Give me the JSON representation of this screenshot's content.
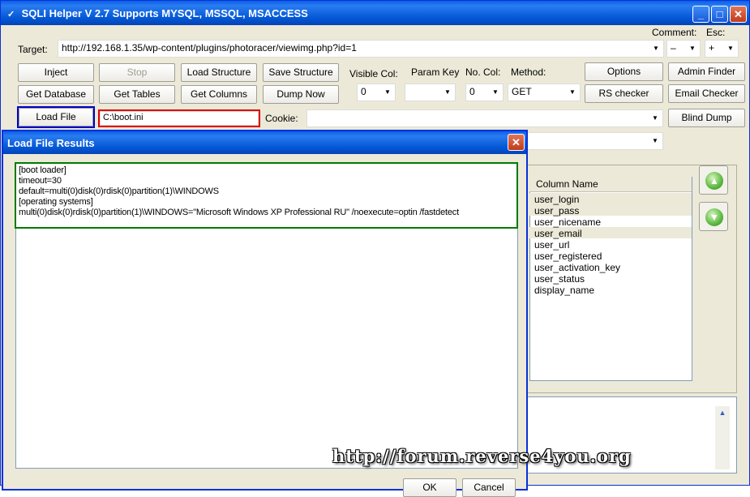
{
  "window": {
    "title": "SQLI Helper V 2.7 Supports MYSQL, MSSQL, MSACCESS"
  },
  "target": {
    "label": "Target:",
    "url": "http://192.168.1.35/wp-content/plugins/photoracer/viewimg.php?id=1"
  },
  "comment": {
    "label": "Comment:",
    "value": "–"
  },
  "esc": {
    "label": "Esc:",
    "value": "+"
  },
  "buttons": {
    "inject": "Inject",
    "stop": "Stop",
    "load_structure": "Load Structure",
    "save_structure": "Save Structure",
    "get_database": "Get Database",
    "get_tables": "Get Tables",
    "get_columns": "Get Columns",
    "dump_now": "Dump Now",
    "load_file": "Load File",
    "options": "Options",
    "admin_finder": "Admin Finder",
    "rs_checker": "RS checker",
    "email_checker": "Email Checker",
    "blind_dump": "Blind Dump",
    "ok": "OK",
    "cancel": "Cancel"
  },
  "visible_col": {
    "label": "Visible Col:",
    "value": "0"
  },
  "param_key": {
    "label": "Param Key",
    "value": ""
  },
  "no_col": {
    "label": "No. Col:",
    "value": "0"
  },
  "method": {
    "label": "Method:",
    "value": "GET"
  },
  "load_file_path": "C:\\boot.ini",
  "cookie": {
    "label": "Cookie:",
    "value": ""
  },
  "columns": {
    "header": "Column Name",
    "items": [
      "user_login",
      "user_pass",
      "user_nicename",
      "user_email",
      "user_url",
      "user_registered",
      "user_activation_key",
      "user_status",
      "display_name"
    ]
  },
  "dialog": {
    "title": "Load File Results",
    "lines": [
      "[boot loader]",
      "timeout=30",
      "default=multi(0)disk(0)rdisk(0)partition(1)\\WINDOWS",
      "[operating systems]",
      "multi(0)disk(0)rdisk(0)partition(1)\\WINDOWS=\"Microsoft Windows XP Professional RU\" /noexecute=optin /fastdetect"
    ]
  },
  "watermark": "http://forum.reverse4you.org"
}
